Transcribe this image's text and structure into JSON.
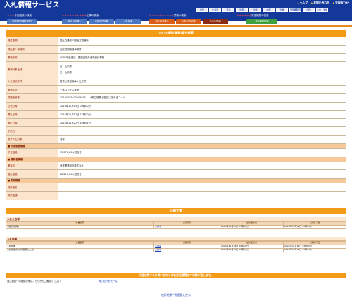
{
  "header": {
    "title": "入札情報サービス",
    "links": [
      "ヘルプ",
      "お問い合わせ",
      "全国版TOP"
    ],
    "regions": [
      "全国",
      "北海道",
      "東北",
      "関東",
      "北陸",
      "中部",
      "近畿",
      "中国",
      "四国",
      "九州・沖縄"
    ],
    "groups": {
      "info": {
        "label": "今回相談の検索",
        "mark": "＊＊＊"
      },
      "construction": {
        "label": "工事の検索",
        "mark": "＊＊＊＊＊＊＊＊＊＊"
      },
      "service": {
        "label": "業務の検索",
        "mark": "＊＊＊＊＊＊＊＊＊＊"
      },
      "orderer": {
        "label": "発注機関の検索",
        "mark": "＊＊＊＊＊＊"
      }
    },
    "buttons": {
      "b1": "今回相談情報(検索)",
      "b2": "発注の見通し",
      "b3": "入札公告情報",
      "b4": "入札結果",
      "b5": "発注の見通し",
      "b6": "入札公告情報",
      "b7": "入札の結果",
      "b8": "発注機関情報"
    }
  },
  "detail": {
    "title": "入札の経過(業務)案件概要",
    "rows": [
      {
        "label": "発注機関",
        "value": "国土交通省中国地方整備局"
      },
      {
        "label": "発注者・事務所",
        "value": "山陰西部国道事務所"
      },
      {
        "label": "業務名称",
        "value": "令和5年度渡辺・豊田道路外道路設計業務"
      },
      {
        "label": "業務対象地域",
        "value": "自：山口県",
        "value2": "至：山口県"
      },
      {
        "label": "入札契約方式",
        "value": "簡易公募型競争入札方式"
      },
      {
        "label": "業務区分",
        "value": "土木コンサル業務"
      },
      {
        "label": "調達番号等",
        "value": "20230707400206025",
        "note": "※発注機関が独自に定めるコード"
      },
      {
        "label": "公告日時",
        "value": "2023年10月03日 09時00分"
      },
      {
        "label": "開札日時",
        "value": "2023年11月12日 17時00分"
      },
      {
        "label": "開札日時",
        "value": "2023年11月22日 10時01分"
      },
      {
        "label": "予約日",
        "value": ""
      },
      {
        "label": "電子入札対象",
        "value": "対象"
      }
    ],
    "sections": {
      "yotei": "予定価格情報",
      "rakusatsu": "落札者情報",
      "keiyaku": "契約情報"
    },
    "yotei_label": "予定価格",
    "yotei_value": "35,570,000(税抜き)",
    "winner_label": "業者名",
    "winner_value": "東洋開発設計株式会社",
    "price_label": "落札価格",
    "price_value": "28,210,000(税抜き)",
    "contract_label": "契約者名",
    "contract_amount_label": "契約金額"
  },
  "docs": {
    "title": "公開文書",
    "koukoku": {
      "heading": "入札公告等",
      "columns": [
        "文書名称",
        "公開状況",
        "最新更新日",
        "公開終了日"
      ],
      "rows": [
        {
          "name": "※開示(随時)",
          "status": "公開中",
          "updated": "2023年10月03日 07時00分",
          "end": "2025年03月31日 23時59分"
        }
      ]
    },
    "kekka": {
      "heading": "入札結果",
      "columns": [
        "文書名称",
        "公開状況",
        "最新更新日",
        "公開終了日"
      ],
      "rows": [
        {
          "name": "入札調書",
          "status": "公開中",
          "updated": "2023年11月28日 09時10分",
          "end": "2025年03月31日 23時59分"
        },
        {
          "name": "入札調書(総合評価落札方式)",
          "status": "公開中",
          "updated": "2023年11月28日 09時10分",
          "end": "2025年03月31日 23時59分"
        }
      ]
    }
  },
  "contact": {
    "title": "内容に関するお問い合わせは各発注機関までお願い致します。",
    "text": "発注機関への連絡先等はこちらからご確認ください。",
    "link": "問い合わせ先一覧"
  },
  "footer": {
    "back_link": "検索結果一覧画面に戻る"
  }
}
